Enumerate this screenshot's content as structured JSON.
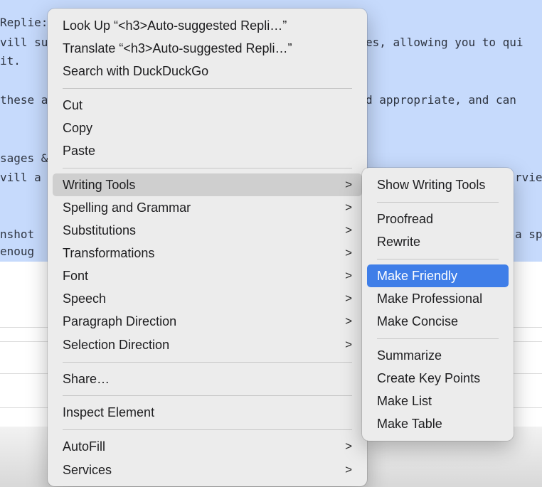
{
  "editor": {
    "lines": [
      {
        "left": "Replie:",
        "right": ""
      },
      {
        "left": "vill su",
        "right": "es, allowing you to qui"
      },
      {
        "left": "it.",
        "right": ""
      },
      {
        "left": "these a",
        "right": "d appropriate, and can"
      },
      {
        "left": "sages &",
        "right": ""
      },
      {
        "left": "vill a",
        "right": "rvie"
      },
      {
        "left": "nshot",
        "right": "a sp"
      },
      {
        "left": "enoug",
        "right": ""
      }
    ]
  },
  "context_menu": {
    "items": [
      {
        "label": "Look Up “<h3>Auto-suggested Repli…”",
        "submenu": false
      },
      {
        "label": "Translate “<h3>Auto-suggested Repli…”",
        "submenu": false
      },
      {
        "label": "Search with DuckDuckGo",
        "submenu": false
      },
      {
        "label": "Cut",
        "submenu": false
      },
      {
        "label": "Copy",
        "submenu": false
      },
      {
        "label": "Paste",
        "submenu": false
      },
      {
        "label": "Writing Tools",
        "submenu": true
      },
      {
        "label": "Spelling and Grammar",
        "submenu": true
      },
      {
        "label": "Substitutions",
        "submenu": true
      },
      {
        "label": "Transformations",
        "submenu": true
      },
      {
        "label": "Font",
        "submenu": true
      },
      {
        "label": "Speech",
        "submenu": true
      },
      {
        "label": "Paragraph Direction",
        "submenu": true
      },
      {
        "label": "Selection Direction",
        "submenu": true
      },
      {
        "label": "Share…",
        "submenu": false
      },
      {
        "label": "Inspect Element",
        "submenu": false
      },
      {
        "label": "AutoFill",
        "submenu": true
      },
      {
        "label": "Services",
        "submenu": true
      }
    ],
    "chevron": ">"
  },
  "writing_tools_menu": {
    "items": [
      {
        "label": "Show Writing Tools"
      },
      {
        "label": "Proofread"
      },
      {
        "label": "Rewrite"
      },
      {
        "label": "Make Friendly"
      },
      {
        "label": "Make Professional"
      },
      {
        "label": "Make Concise"
      },
      {
        "label": "Summarize"
      },
      {
        "label": "Create Key Points"
      },
      {
        "label": "Make List"
      },
      {
        "label": "Make Table"
      }
    ]
  },
  "colors": {
    "selection": "#c6dafc",
    "highlight": "#3f7ee8",
    "menu_bg": "#ececec"
  }
}
